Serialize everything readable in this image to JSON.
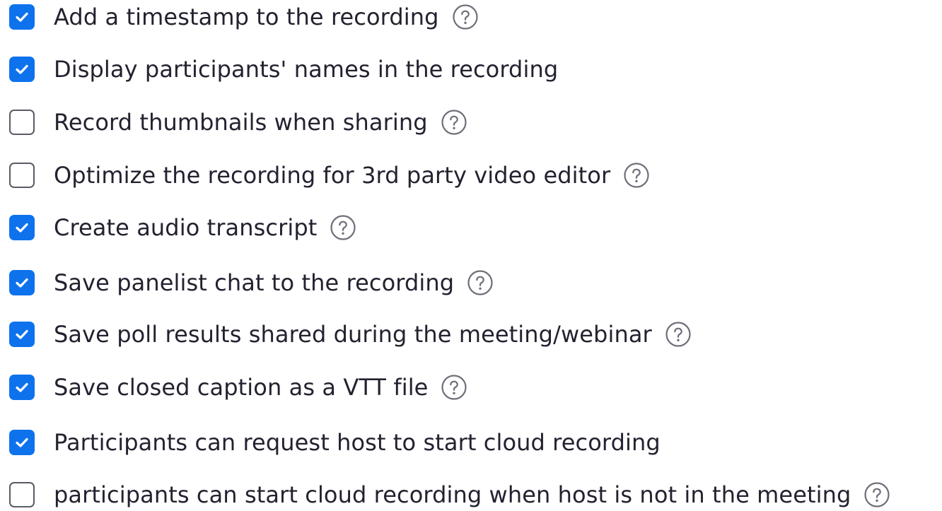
{
  "options": [
    {
      "label": "Add a timestamp to the recording",
      "checked": true,
      "help": true
    },
    {
      "label": "Display participants' names in the recording",
      "checked": true,
      "help": false
    },
    {
      "label": "Record thumbnails when sharing",
      "checked": false,
      "help": true
    },
    {
      "label": "Optimize the recording for 3rd party video editor",
      "checked": false,
      "help": true
    },
    {
      "label": "Create audio transcript",
      "checked": true,
      "help": true
    },
    {
      "label": "Save panelist chat to the recording",
      "checked": true,
      "help": true
    },
    {
      "label": "Save poll results shared during the meeting/webinar",
      "checked": true,
      "help": true
    },
    {
      "label": "Save closed caption as a VTT file",
      "checked": true,
      "help": true
    },
    {
      "label": "Participants can request host to start cloud recording",
      "checked": true,
      "help": false
    },
    {
      "label": "participants can start cloud recording when host is not in the meeting",
      "checked": false,
      "help": true
    }
  ],
  "icons": {
    "checkbox_checked": "checkmark-icon",
    "help": "question-circle-icon"
  },
  "colors": {
    "accent": "#0e72ed",
    "text": "#222230",
    "border": "#5b5b66"
  }
}
